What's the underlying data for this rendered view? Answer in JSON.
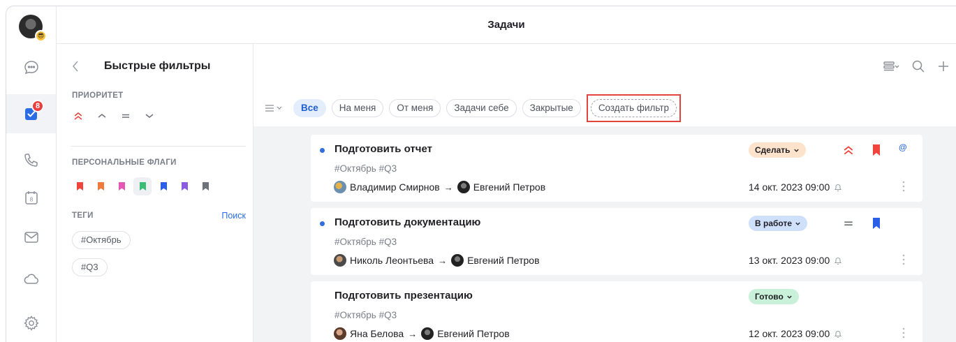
{
  "app": {
    "title": "Задачи"
  },
  "rail": {
    "tasks_badge": "8"
  },
  "filters_panel": {
    "title": "Быстрые фильтры",
    "priority_label": "ПРИОРИТЕТ",
    "flags_label": "ПЕРСОНАЛЬНЫЕ ФЛАГИ",
    "flag_colors": [
      "#f0443c",
      "#f07a3c",
      "#e457b5",
      "#3bbd78",
      "#2b5fe8",
      "#8b5ce0",
      "#6e737c"
    ],
    "tags_label": "ТЕГИ",
    "tags_search": "Поиск",
    "tags": [
      "#Октябрь",
      "#Q3"
    ]
  },
  "filter_chips": [
    {
      "label": "Все",
      "active": true
    },
    {
      "label": "На меня"
    },
    {
      "label": "От меня"
    },
    {
      "label": "Задачи себе"
    },
    {
      "label": "Закрытые"
    }
  ],
  "create_filter_label": "Создать фильтр",
  "tasks": [
    {
      "title": "Подготовить отчет",
      "tags": "#Октябрь #Q3",
      "from": "Владимир Смирнов",
      "to": "Евгений Петров",
      "status": "Сделать",
      "status_bg": "#fde3cc",
      "status_fg": "#1f1f24",
      "date": "14 окт. 2023 09:00",
      "mention": "@"
    },
    {
      "title": "Подготовить документацию",
      "tags": "#Октябрь #Q3",
      "from": "Николь Леонтьева",
      "to": "Евгений Петров",
      "status": "В работе",
      "status_bg": "#cfe0fb",
      "status_fg": "#1f1f24",
      "date": "13 окт. 2023 09:00"
    },
    {
      "title": "Подготовить презентацию",
      "tags": "#Октябрь #Q3",
      "from": "Яна Белова",
      "to": "Евгений Петров",
      "status": "Готово",
      "status_bg": "#c9f0d8",
      "status_fg": "#1f1f24",
      "date": "12 окт. 2023 09:00"
    }
  ],
  "colors": {
    "accent": "#2b6de5",
    "highlight_box": "#e2443d",
    "priority_high": "#f0443c",
    "bookmark_red": "#f0443c",
    "bookmark_blue": "#2b5fe8"
  }
}
